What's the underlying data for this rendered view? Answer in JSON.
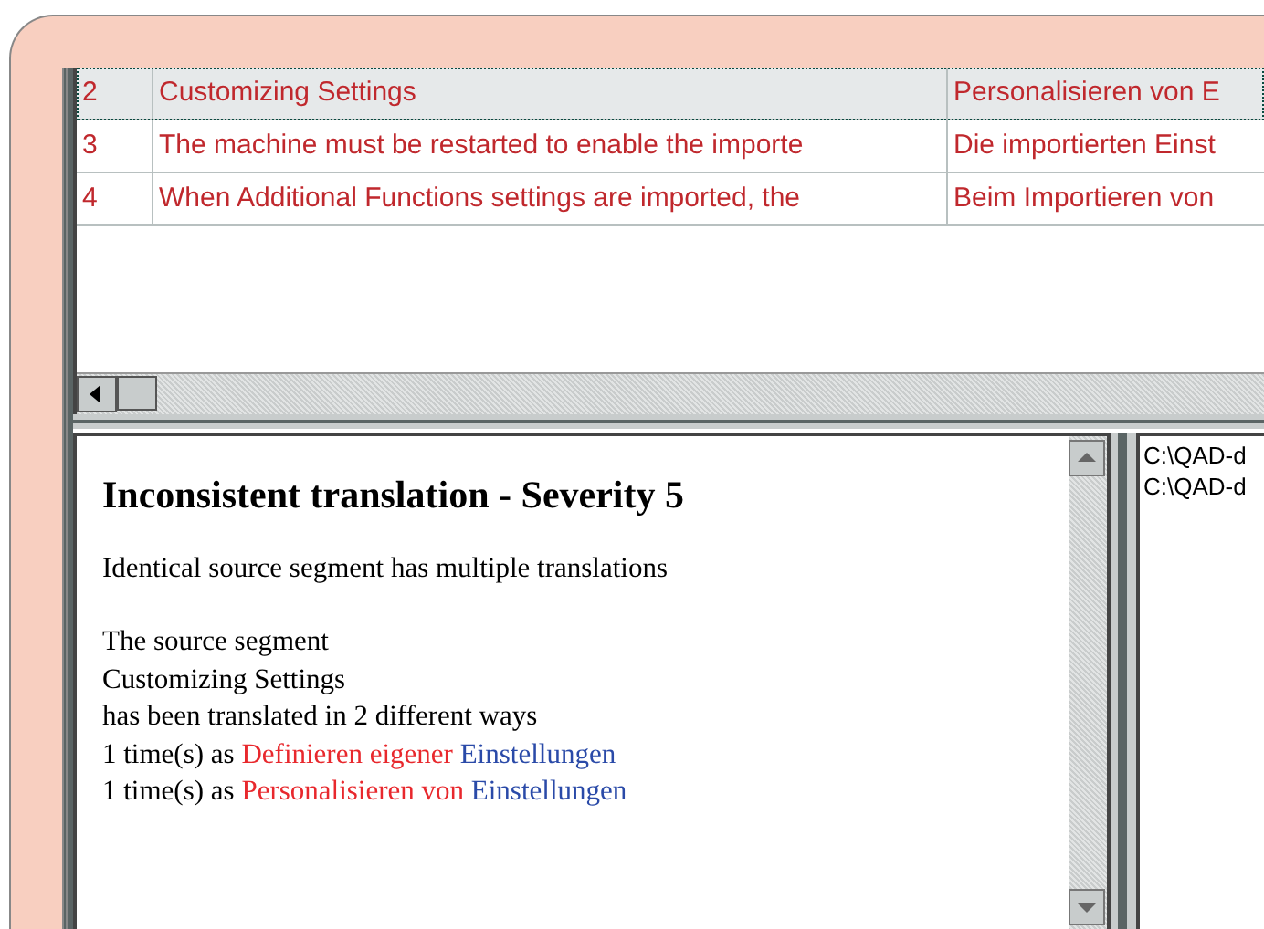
{
  "table": {
    "rows": [
      {
        "cells": [
          "2",
          "Customizing Settings",
          "Personalisieren von E"
        ],
        "selected": true
      },
      {
        "cells": [
          "3",
          "The machine must be restarted to enable the importe",
          "Die importierten Einst"
        ],
        "selected": false
      },
      {
        "cells": [
          "4",
          "When Additional Functions settings are imported, the",
          "Beim Importieren von"
        ],
        "selected": false
      }
    ]
  },
  "report": {
    "title": "Inconsistent translation - Severity 5",
    "summary": "Identical source segment has multiple translations",
    "lines": [
      [
        {
          "text": "The source segment",
          "color": "#000000"
        }
      ],
      [
        {
          "text": "Customizing Settings",
          "color": "#000000"
        }
      ],
      [
        {
          "text": "has been translated in 2 different ways",
          "color": "#000000"
        }
      ],
      [
        {
          "text": "1 time(s) as",
          "color": "#000000"
        },
        {
          "text": "Definieren eigener",
          "color": "#e8282d"
        },
        {
          "text": "Einstellungen",
          "color": "#2a4aa8"
        }
      ],
      [
        {
          "text": "1 time(s) as",
          "color": "#000000"
        },
        {
          "text": "Personalisieren von",
          "color": "#e8282d"
        },
        {
          "text": "Einstellungen",
          "color": "#2a4aa8"
        }
      ]
    ]
  },
  "files": [
    "C:\\QAD-d",
    "C:\\QAD-d"
  ]
}
